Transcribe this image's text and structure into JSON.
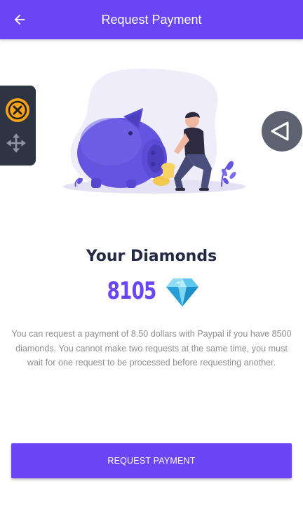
{
  "app_bar": {
    "title": "Request Payment",
    "back_icon": "arrow-left-icon",
    "background": "#6a45f6"
  },
  "floating_controls": {
    "close_icon": "close-circle-icon",
    "move_icon": "move-arrows-icon",
    "side_toggle_icon": "triangle-left-icon"
  },
  "main": {
    "heading": "Your Diamonds",
    "balance": "8105",
    "balance_icon": "diamond-icon",
    "description": "You can request a payment of 8.50 dollars with Paypal if you have 8500 diamonds. You cannot make two requests at the same time, you must wait for one request to be processed before requesting another."
  },
  "actions": {
    "request_button_label": "REQUEST PAYMENT"
  },
  "colors": {
    "accent": "#6a45f6",
    "heading": "#222a45",
    "body_text": "#8e8e8e"
  }
}
